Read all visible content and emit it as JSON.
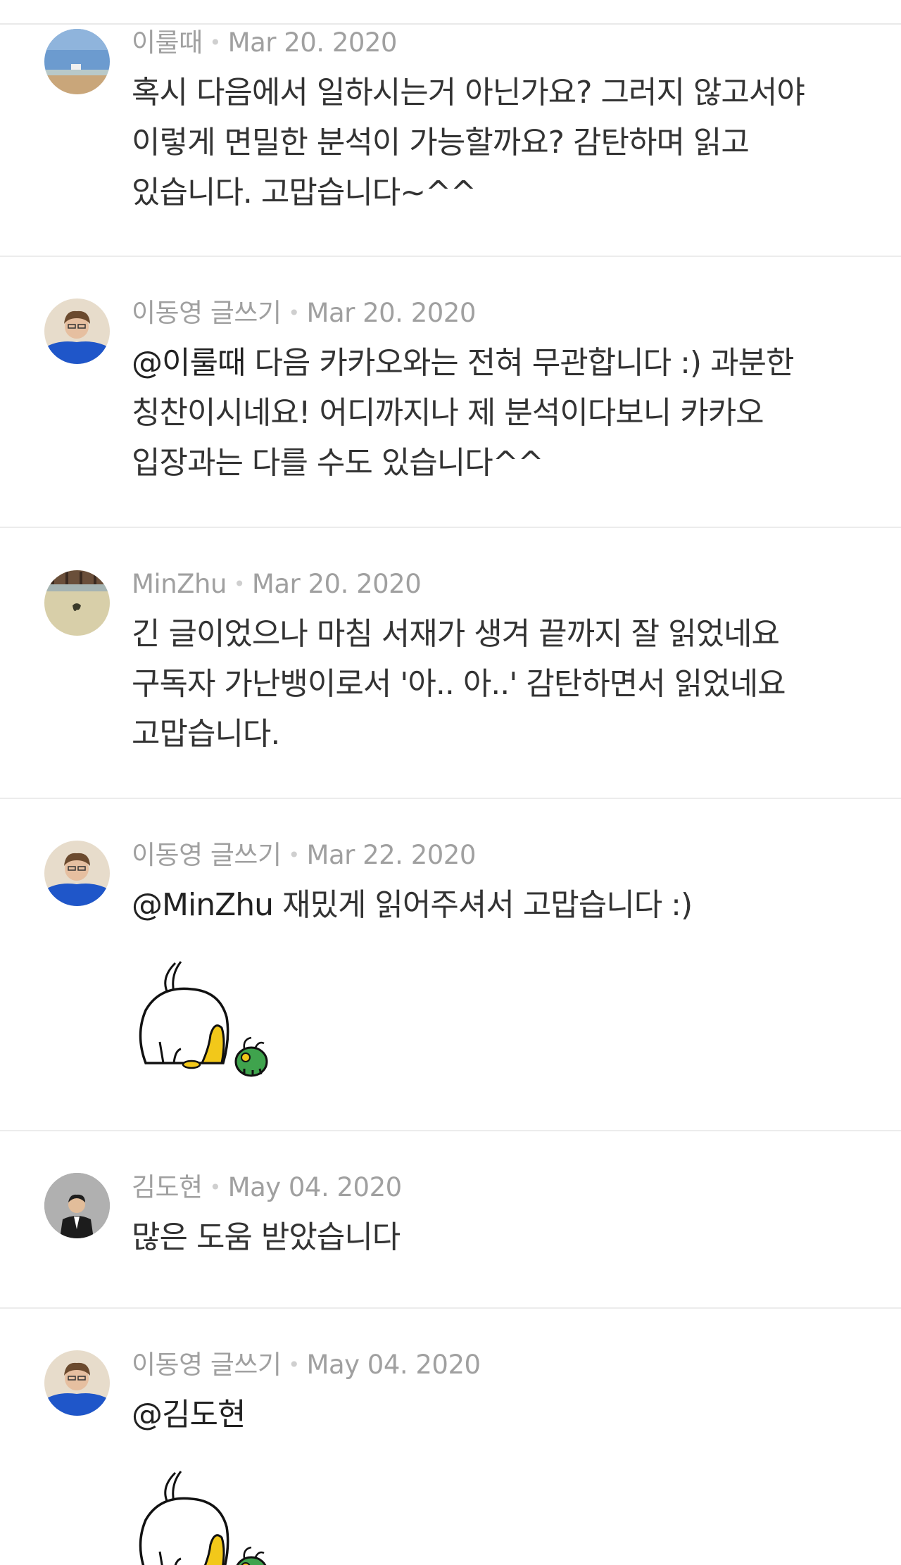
{
  "comments": [
    {
      "author": "이룰때",
      "date": "Mar 20. 2020",
      "mention": "",
      "text": "혹시 다음에서 일하시는거 아닌가요? 그러지 않고서야\n이렇게 면밀한 분석이 가능할까요? 감탄하며 읽고\n있습니다. 고맙습니다~^^",
      "avatar": "beach-photo-avatar"
    },
    {
      "author": "이동영 글쓰기",
      "date": "Mar 20. 2020",
      "mention": "@이룰때",
      "text": " 다음 카카오와는 전혀 무관합니다 :) 과분한\n칭찬이시네요! 어디까지나 제 분석이다보니 카카오\n입장과는 다를 수도 있습니다^^",
      "avatar": "man-blue-jacket-avatar"
    },
    {
      "author": "MinZhu",
      "date": "Mar 20. 2020",
      "mention": "",
      "text": "긴 글이었으나 마침 서재가 생겨 끝까지 잘 읽었네요\n구독자 가난뱅이로서 '아.. 아..' 감탄하면서 읽었네요\n고맙습니다.",
      "avatar": "wall-photo-avatar"
    },
    {
      "author": "이동영 글쓰기",
      "date": "Mar 22. 2020",
      "mention": "@MinZhu",
      "text": " 재밌게 읽어주셔서 고맙습니다 :)",
      "avatar": "man-blue-jacket-avatar",
      "sticker": "bowing-character-sticker"
    },
    {
      "author": "김도현",
      "date": "May 04. 2020",
      "mention": "",
      "text": "많은 도움 받았습니다",
      "avatar": "man-suit-avatar"
    },
    {
      "author": "이동영 글쓰기",
      "date": "May 04. 2020",
      "mention": "@김도현",
      "text": "",
      "avatar": "man-blue-jacket-avatar",
      "sticker": "bowing-character-sticker"
    }
  ]
}
